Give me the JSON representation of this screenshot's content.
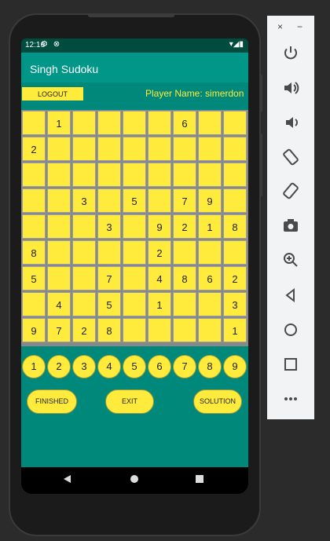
{
  "status_bar": {
    "time": "12:16",
    "left_icons": "⚙ ⊗",
    "right_icons": "▾◢▮"
  },
  "app": {
    "title": "Singh Sudoku"
  },
  "header": {
    "logout_label": "LOGOUT",
    "player_label": "Player Name: simerdon"
  },
  "board": [
    [
      "",
      "1",
      "",
      "",
      "",
      "",
      "6",
      "",
      ""
    ],
    [
      "2",
      "",
      "",
      "",
      "",
      "",
      "",
      "",
      ""
    ],
    [
      "",
      "",
      "",
      "",
      "",
      "",
      "",
      "",
      ""
    ],
    [
      "",
      "",
      "3",
      "",
      "5",
      "",
      "7",
      "9",
      ""
    ],
    [
      "",
      "",
      "",
      "3",
      "",
      "9",
      "2",
      "1",
      "8"
    ],
    [
      "8",
      "",
      "",
      "",
      "",
      "2",
      "",
      "",
      ""
    ],
    [
      "5",
      "",
      "",
      "7",
      "",
      "4",
      "8",
      "6",
      "2"
    ],
    [
      "",
      "4",
      "",
      "5",
      "",
      "1",
      "",
      "",
      "3"
    ],
    [
      "9",
      "7",
      "2",
      "8",
      "",
      "",
      "",
      "",
      "1"
    ]
  ],
  "number_buttons": [
    "1",
    "2",
    "3",
    "4",
    "5",
    "6",
    "7",
    "8",
    "9"
  ],
  "actions": {
    "finished": "FINISHED",
    "exit": "EXIT",
    "solution": "SOLUTION"
  },
  "emulator_panel": {
    "close": "×",
    "minimize": "−",
    "icons": [
      "power-icon",
      "volume-up-icon",
      "volume-down-icon",
      "rotate-left-icon",
      "rotate-right-icon",
      "camera-icon",
      "zoom-icon",
      "back-icon",
      "home-icon",
      "overview-icon",
      "more-icon"
    ]
  }
}
